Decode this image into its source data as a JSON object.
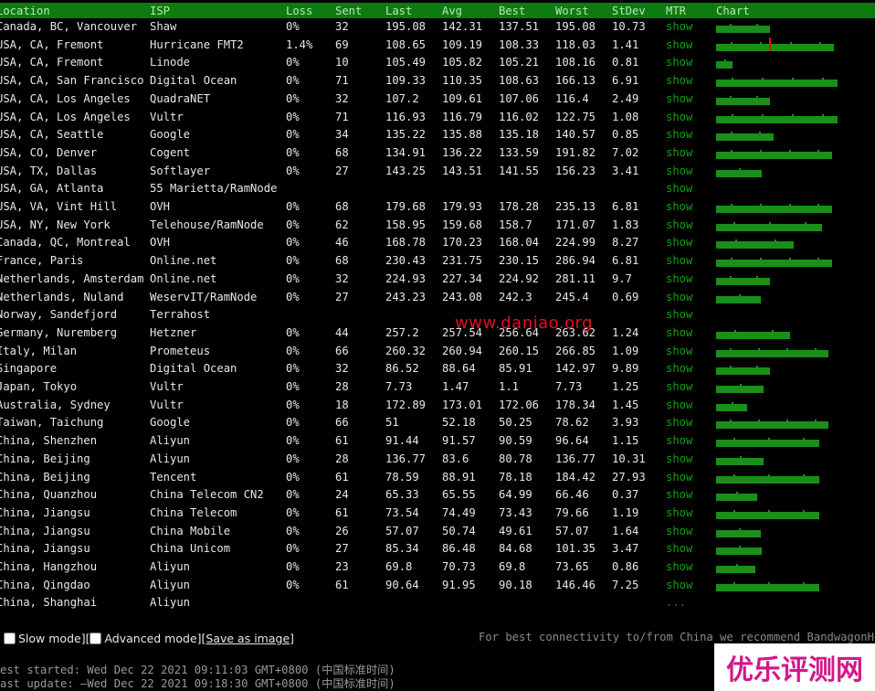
{
  "headers": {
    "location": "Location",
    "isp": "ISP",
    "loss": "Loss",
    "sent": "Sent",
    "last": "Last",
    "avg": "Avg",
    "best": "Best",
    "worst": "Worst",
    "stdev": "StDev",
    "mtr": "MTR",
    "chart": "Chart"
  },
  "rows": [
    {
      "location": "Canada, BC, Vancouver",
      "isp": "Shaw",
      "loss": "0%",
      "sent": "32",
      "last": "195.08",
      "avg": "142.31",
      "best": "137.51",
      "worst": "195.08",
      "stdev": "10.73",
      "mtr": "show",
      "chart_fill": 0.42
    },
    {
      "location": "USA, CA, Fremont",
      "isp": "Hurricane FMT2",
      "loss": "1.4%",
      "sent": "69",
      "last": "108.65",
      "avg": "109.19",
      "best": "108.33",
      "worst": "118.03",
      "stdev": "1.41",
      "mtr": "show",
      "chart_fill": 0.92
    },
    {
      "location": "USA, CA, Fremont",
      "isp": "Linode",
      "loss": "0%",
      "sent": "10",
      "last": "105.49",
      "avg": "105.82",
      "best": "105.21",
      "worst": "108.16",
      "stdev": "0.81",
      "mtr": "show",
      "chart_fill": 0.13
    },
    {
      "location": "USA, CA, San Francisco",
      "isp": "Digital Ocean",
      "loss": "0%",
      "sent": "71",
      "last": "109.33",
      "avg": "110.35",
      "best": "108.63",
      "worst": "166.13",
      "stdev": "6.91",
      "mtr": "show",
      "chart_fill": 0.95
    },
    {
      "location": "USA, CA, Los Angeles",
      "isp": "QuadraNET",
      "loss": "0%",
      "sent": "32",
      "last": "107.2",
      "avg": "109.61",
      "best": "107.06",
      "worst": "116.4",
      "stdev": "2.49",
      "mtr": "show",
      "chart_fill": 0.42
    },
    {
      "location": "USA, CA, Los Angeles",
      "isp": "Vultr",
      "loss": "0%",
      "sent": "71",
      "last": "116.93",
      "avg": "116.79",
      "best": "116.02",
      "worst": "122.75",
      "stdev": "1.08",
      "mtr": "show",
      "chart_fill": 0.95
    },
    {
      "location": "USA, CA, Seattle",
      "isp": "Google",
      "loss": "0%",
      "sent": "34",
      "last": "135.22",
      "avg": "135.88",
      "best": "135.18",
      "worst": "140.57",
      "stdev": "0.85",
      "mtr": "show",
      "chart_fill": 0.45
    },
    {
      "location": "USA, CO, Denver",
      "isp": "Cogent",
      "loss": "0%",
      "sent": "68",
      "last": "134.91",
      "avg": "136.22",
      "best": "133.59",
      "worst": "191.82",
      "stdev": "7.02",
      "mtr": "show",
      "chart_fill": 0.91
    },
    {
      "location": "USA, TX, Dallas",
      "isp": "Softlayer",
      "loss": "0%",
      "sent": "27",
      "last": "143.25",
      "avg": "143.51",
      "best": "141.55",
      "worst": "156.23",
      "stdev": "3.41",
      "mtr": "show",
      "chart_fill": 0.36
    },
    {
      "location": "USA, GA, Atlanta",
      "isp": "55 Marietta/RamNode",
      "loss": "",
      "sent": "",
      "last": "",
      "avg": "",
      "best": "",
      "worst": "",
      "stdev": "",
      "mtr": "show",
      "chart_fill": 0
    },
    {
      "location": "USA, VA, Vint Hill",
      "isp": "OVH",
      "loss": "0%",
      "sent": "68",
      "last": "179.68",
      "avg": "179.93",
      "best": "178.28",
      "worst": "235.13",
      "stdev": "6.81",
      "mtr": "show",
      "chart_fill": 0.91
    },
    {
      "location": "USA, NY, New York",
      "isp": "Telehouse/RamNode",
      "loss": "0%",
      "sent": "62",
      "last": "158.95",
      "avg": "159.68",
      "best": "158.7",
      "worst": "171.07",
      "stdev": "1.83",
      "mtr": "show",
      "chart_fill": 0.83
    },
    {
      "location": "Canada, QC, Montreal",
      "isp": "OVH",
      "loss": "0%",
      "sent": "46",
      "last": "168.78",
      "avg": "170.23",
      "best": "168.04",
      "worst": "224.99",
      "stdev": "8.27",
      "mtr": "show",
      "chart_fill": 0.61
    },
    {
      "location": "France, Paris",
      "isp": "Online.net",
      "loss": "0%",
      "sent": "68",
      "last": "230.43",
      "avg": "231.75",
      "best": "230.15",
      "worst": "286.94",
      "stdev": "6.81",
      "mtr": "show",
      "chart_fill": 0.91
    },
    {
      "location": "Netherlands, Amsterdam",
      "isp": "Online.net",
      "loss": "0%",
      "sent": "32",
      "last": "224.93",
      "avg": "227.34",
      "best": "224.92",
      "worst": "281.11",
      "stdev": "9.7",
      "mtr": "show",
      "chart_fill": 0.42
    },
    {
      "location": "Netherlands, Nuland",
      "isp": "WeservIT/RamNode",
      "loss": "0%",
      "sent": "27",
      "last": "243.23",
      "avg": "243.08",
      "best": "242.3",
      "worst": "245.4",
      "stdev": "0.69",
      "mtr": "show",
      "chart_fill": 0.35
    },
    {
      "location": "Norway, Sandefjord",
      "isp": "Terrahost",
      "loss": "",
      "sent": "",
      "last": "",
      "avg": "",
      "best": "",
      "worst": "",
      "stdev": "",
      "mtr": "show",
      "chart_fill": 0
    },
    {
      "location": "Germany, Nuremberg",
      "isp": "Hetzner",
      "loss": "0%",
      "sent": "44",
      "last": "257.2",
      "avg": "257.54",
      "best": "256.64",
      "worst": "263.62",
      "stdev": "1.24",
      "mtr": "show",
      "chart_fill": 0.58
    },
    {
      "location": "Italy, Milan",
      "isp": "Prometeus",
      "loss": "0%",
      "sent": "66",
      "last": "260.32",
      "avg": "260.94",
      "best": "260.15",
      "worst": "266.85",
      "stdev": "1.09",
      "mtr": "show",
      "chart_fill": 0.88
    },
    {
      "location": "Singapore",
      "isp": "Digital Ocean",
      "loss": "0%",
      "sent": "32",
      "last": "86.52",
      "avg": "88.64",
      "best": "85.91",
      "worst": "142.97",
      "stdev": "9.89",
      "mtr": "show",
      "chart_fill": 0.42
    },
    {
      "location": "Japan, Tokyo",
      "isp": "Vultr",
      "loss": "0%",
      "sent": "28",
      "last": "7.73",
      "avg": "1.47",
      "best": "1.1",
      "worst": "7.73",
      "stdev": "1.25",
      "mtr": "show",
      "chart_fill": 0.37
    },
    {
      "location": "Australia, Sydney",
      "isp": "Vultr",
      "loss": "0%",
      "sent": "18",
      "last": "172.89",
      "avg": "173.01",
      "best": "172.06",
      "worst": "178.34",
      "stdev": "1.45",
      "mtr": "show",
      "chart_fill": 0.24
    },
    {
      "location": "Taiwan, Taichung",
      "isp": "Google",
      "loss": "0%",
      "sent": "66",
      "last": "51",
      "avg": "52.18",
      "best": "50.25",
      "worst": "78.62",
      "stdev": "3.93",
      "mtr": "show",
      "chart_fill": 0.88
    },
    {
      "location": "China, Shenzhen",
      "isp": "Aliyun",
      "loss": "0%",
      "sent": "61",
      "last": "91.44",
      "avg": "91.57",
      "best": "90.59",
      "worst": "96.64",
      "stdev": "1.15",
      "mtr": "show",
      "chart_fill": 0.81
    },
    {
      "location": "China, Beijing",
      "isp": "Aliyun",
      "loss": "0%",
      "sent": "28",
      "last": "136.77",
      "avg": "83.6",
      "best": "80.78",
      "worst": "136.77",
      "stdev": "10.31",
      "mtr": "show",
      "chart_fill": 0.37
    },
    {
      "location": "China, Beijing",
      "isp": "Tencent",
      "loss": "0%",
      "sent": "61",
      "last": "78.59",
      "avg": "88.91",
      "best": "78.18",
      "worst": "184.42",
      "stdev": "27.93",
      "mtr": "show",
      "chart_fill": 0.81
    },
    {
      "location": "China, Quanzhou",
      "isp": "China Telecom CN2",
      "loss": "0%",
      "sent": "24",
      "last": "65.33",
      "avg": "65.55",
      "best": "64.99",
      "worst": "66.46",
      "stdev": "0.37",
      "mtr": "show",
      "chart_fill": 0.32
    },
    {
      "location": "China, Jiangsu",
      "isp": "China Telecom",
      "loss": "0%",
      "sent": "61",
      "last": "73.54",
      "avg": "74.49",
      "best": "73.43",
      "worst": "79.66",
      "stdev": "1.19",
      "mtr": "show",
      "chart_fill": 0.81
    },
    {
      "location": "China, Jiangsu",
      "isp": "China Mobile",
      "loss": "0%",
      "sent": "26",
      "last": "57.07",
      "avg": "50.74",
      "best": "49.61",
      "worst": "57.07",
      "stdev": "1.64",
      "mtr": "show",
      "chart_fill": 0.35
    },
    {
      "location": "China, Jiangsu",
      "isp": "China Unicom",
      "loss": "0%",
      "sent": "27",
      "last": "85.34",
      "avg": "86.48",
      "best": "84.68",
      "worst": "101.35",
      "stdev": "3.47",
      "mtr": "show",
      "chart_fill": 0.36
    },
    {
      "location": "China, Hangzhou",
      "isp": "Aliyun",
      "loss": "0%",
      "sent": "23",
      "last": "69.8",
      "avg": "70.73",
      "best": "69.8",
      "worst": "73.65",
      "stdev": "0.86",
      "mtr": "show",
      "chart_fill": 0.31
    },
    {
      "location": "China, Qingdao",
      "isp": "Aliyun",
      "loss": "0%",
      "sent": "61",
      "last": "90.64",
      "avg": "91.95",
      "best": "90.18",
      "worst": "146.46",
      "stdev": "7.25",
      "mtr": "show",
      "chart_fill": 0.81
    },
    {
      "location": "China, Shanghai",
      "isp": "Aliyun",
      "loss": "",
      "sent": "",
      "last": "",
      "avg": "",
      "best": "",
      "worst": "",
      "stdev": "",
      "mtr": "...",
      "chart_fill": 0
    }
  ],
  "controls": {
    "slow_mode": "Slow mode",
    "advanced_mode": "Advanced mode",
    "save_image": "Save as image"
  },
  "promo": "For best connectivity to/from China we recommend BandwagonHos",
  "test_started": "est started: Wed Dec 22 2021 09:11:03 GMT+0800 (中国标准时间)",
  "last_update": "ast update: —Wed Dec 22 2021 09:18:30 GMT+0800 (中国标准时间)",
  "watermark": "www.daniao.org",
  "badge_text": "优乐评测网",
  "colors": {
    "header_bg": "#0c7c0c",
    "show_link": "#12a012",
    "chart_bar": "#1a8f1a",
    "loss_spike": "#e01010"
  }
}
